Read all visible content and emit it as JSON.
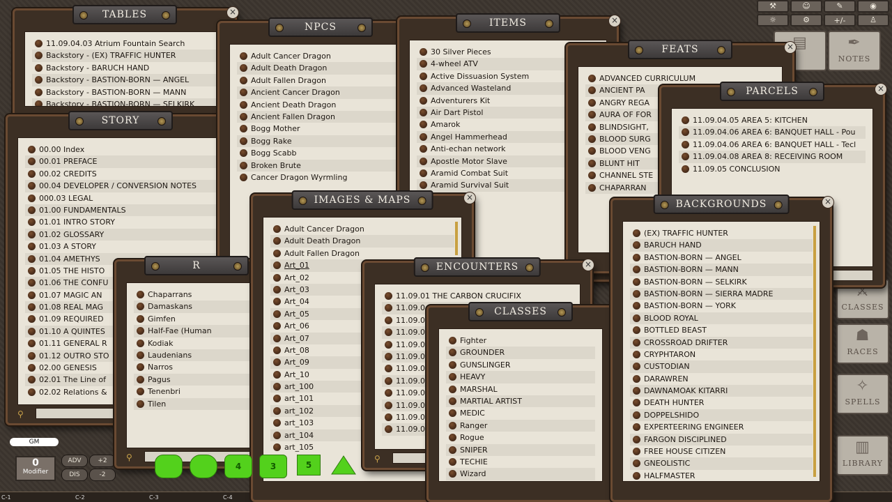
{
  "windows": {
    "tables": {
      "title": "TABLES",
      "items": [
        "11.09.04.03 Atrium Fountain Search",
        "Backstory - (EX) TRAFFIC HUNTER",
        "Backstory - BARUCH HAND",
        "Backstory - BASTION-BORN — ANGEL",
        "Backstory - BASTION-BORN — MANN",
        "Backstory - BASTION-BORN — SELKIRK"
      ]
    },
    "story": {
      "title": "STORY",
      "items": [
        "00.00 Index",
        "00.01 PREFACE",
        "00.02 CREDITS",
        "00.04 DEVELOPER / CONVERSION NOTES",
        "000.03 LEGAL",
        "01.00 FUNDAMENTALS",
        "01.01 INTRO STORY",
        "01.02 GLOSSARY",
        "01.03 A STORY",
        "01.04 AMETHYS",
        "01.05 THE HISTO",
        "01.06 THE CONFU",
        "01.07 MAGIC AN",
        "01.08 REAL MAG",
        "01.09 REQUIRED",
        "01.10 A QUINTES",
        "01.11 GENERAL R",
        "01.12 OUTRO STO",
        "02.00 GENESIS",
        "02.01 The Line of",
        "02.02 Relations &"
      ]
    },
    "npcs": {
      "title": "NPCS",
      "items": [
        "Adult Cancer Dragon",
        "Adult Death Dragon",
        "Adult Fallen Dragon",
        "Ancient Cancer Dragon",
        "Ancient Death Dragon",
        "Ancient Fallen Dragon",
        "Bogg Mother",
        "Bogg Rake",
        "Bogg Scabb",
        "Broken Brute",
        "Cancer Dragon Wyrmling"
      ]
    },
    "items": {
      "title": "ITEMS",
      "items": [
        "30 Silver Pieces",
        "4-wheel ATV",
        "Active Dissuasion System",
        "Advanced Wasteland",
        "Adventurers Kit",
        "Air Dart Pistol",
        "Amarok",
        "Angel Hammerhead",
        "Anti-echan network",
        "Apostle Motor Slave",
        "Aramid Combat Suit",
        "Aramid Survival Suit"
      ]
    },
    "feats": {
      "title": "FEATS",
      "items": [
        "ADVANCED CURRICULUM",
        "ANCIENT PA",
        "ANGRY REGA",
        "AURA OF FOR",
        "BLINDSIGHT,",
        "BLOOD SURG",
        "BLOOD VENG",
        "BLUNT HIT",
        "CHANNEL STE",
        "CHAPARRAN"
      ]
    },
    "parcels": {
      "title": "PARCELS",
      "items": [
        "11.09.04.05 AREA 5: KITCHEN",
        "11.09.04.06 AREA 6: BANQUET HALL - Pou",
        "11.09.04.06 AREA 6: BANQUET HALL - Tecl",
        "11.09.04.08 AREA 8: RECEIVING ROOM",
        "11.09.05 CONCLUSION"
      ]
    },
    "races": {
      "title": "R",
      "items": [
        "Chaparrans",
        "Damaskans",
        "Gimfen",
        "Half-Fae (Human",
        "Kodiak",
        "Laudenians",
        "Narros",
        "Pagus",
        "Tenenbri",
        "Tilen"
      ]
    },
    "images": {
      "title": "IMAGES & MAPS",
      "items": [
        "Adult Cancer Dragon",
        "Adult Death Dragon",
        "Adult Fallen Dragon",
        "Art_01",
        "Art_02",
        "Art_03",
        "Art_04",
        "Art_05",
        "Art_06",
        "Art_07",
        "Art_08",
        "Art_09",
        "Art_10",
        "art_100",
        "art_101",
        "art_102",
        "art_103",
        "art_104",
        "art_105"
      ]
    },
    "encounters": {
      "title": "ENCOUNTERS",
      "items": [
        "11.09.01 THE CARBON CRUCIFIX",
        "11.09.0",
        "11.09.0",
        "11.09.0",
        "11.09.0",
        "11.09.0",
        "11.09.0",
        "11.09.0",
        "11.09.0",
        "11.09.0",
        "11.09.0",
        "11.09.0"
      ]
    },
    "classes": {
      "title": "CLASSES",
      "items": [
        "Fighter",
        "GROUNDER",
        "GUNSLINGER",
        "HEAVY",
        "MARSHAL",
        "MARTIAL ARTIST",
        "MEDIC",
        "Ranger",
        "Rogue",
        "SNIPER",
        "TECHIE",
        "Wizard"
      ]
    },
    "backgrounds": {
      "title": "BACKGROUNDS",
      "items": [
        "(EX) TRAFFIC HUNTER",
        "BARUCH HAND",
        "BASTION-BORN — ANGEL",
        "BASTION-BORN — MANN",
        "BASTION-BORN — SELKIRK",
        "BASTION-BORN — SIERRA MADRE",
        "BASTION-BORN — YORK",
        "BLOOD ROYAL",
        "BOTTLED BEAST",
        "CROSSROAD DRIFTER",
        "CRYPHTARON",
        "CUSTODIAN",
        "DARAWREN",
        "DAWNAMOAK KITARRI",
        "DEATH HUNTER",
        "DOPPELSHIDO",
        "EXPERTEERING ENGINEER",
        "FARGON DISCIPLINED",
        "FREE HOUSE CITIZEN",
        "GNEOLISTIC",
        "HALFMASTER"
      ]
    }
  },
  "sidebar": {
    "notes": "NOTES",
    "classes": "CLASSES",
    "races": "RACES",
    "spells": "SPELLS",
    "library": "LIBRARY",
    "toolbar": [
      "+/-"
    ]
  },
  "bottom": {
    "gm": "GM",
    "modifier_value": "0",
    "modifier_label": "Modifier",
    "adv": "ADV",
    "dis": "DIS",
    "plus2": "+2",
    "minus2": "-2",
    "cells": [
      "C-1",
      "C-2",
      "C-3",
      "C-4"
    ],
    "dice": [
      "4",
      "3",
      "5"
    ]
  },
  "colors": {
    "accent_green": "#53d11c",
    "parchment": "#e9e4d8",
    "frame": "#3c2f24"
  }
}
